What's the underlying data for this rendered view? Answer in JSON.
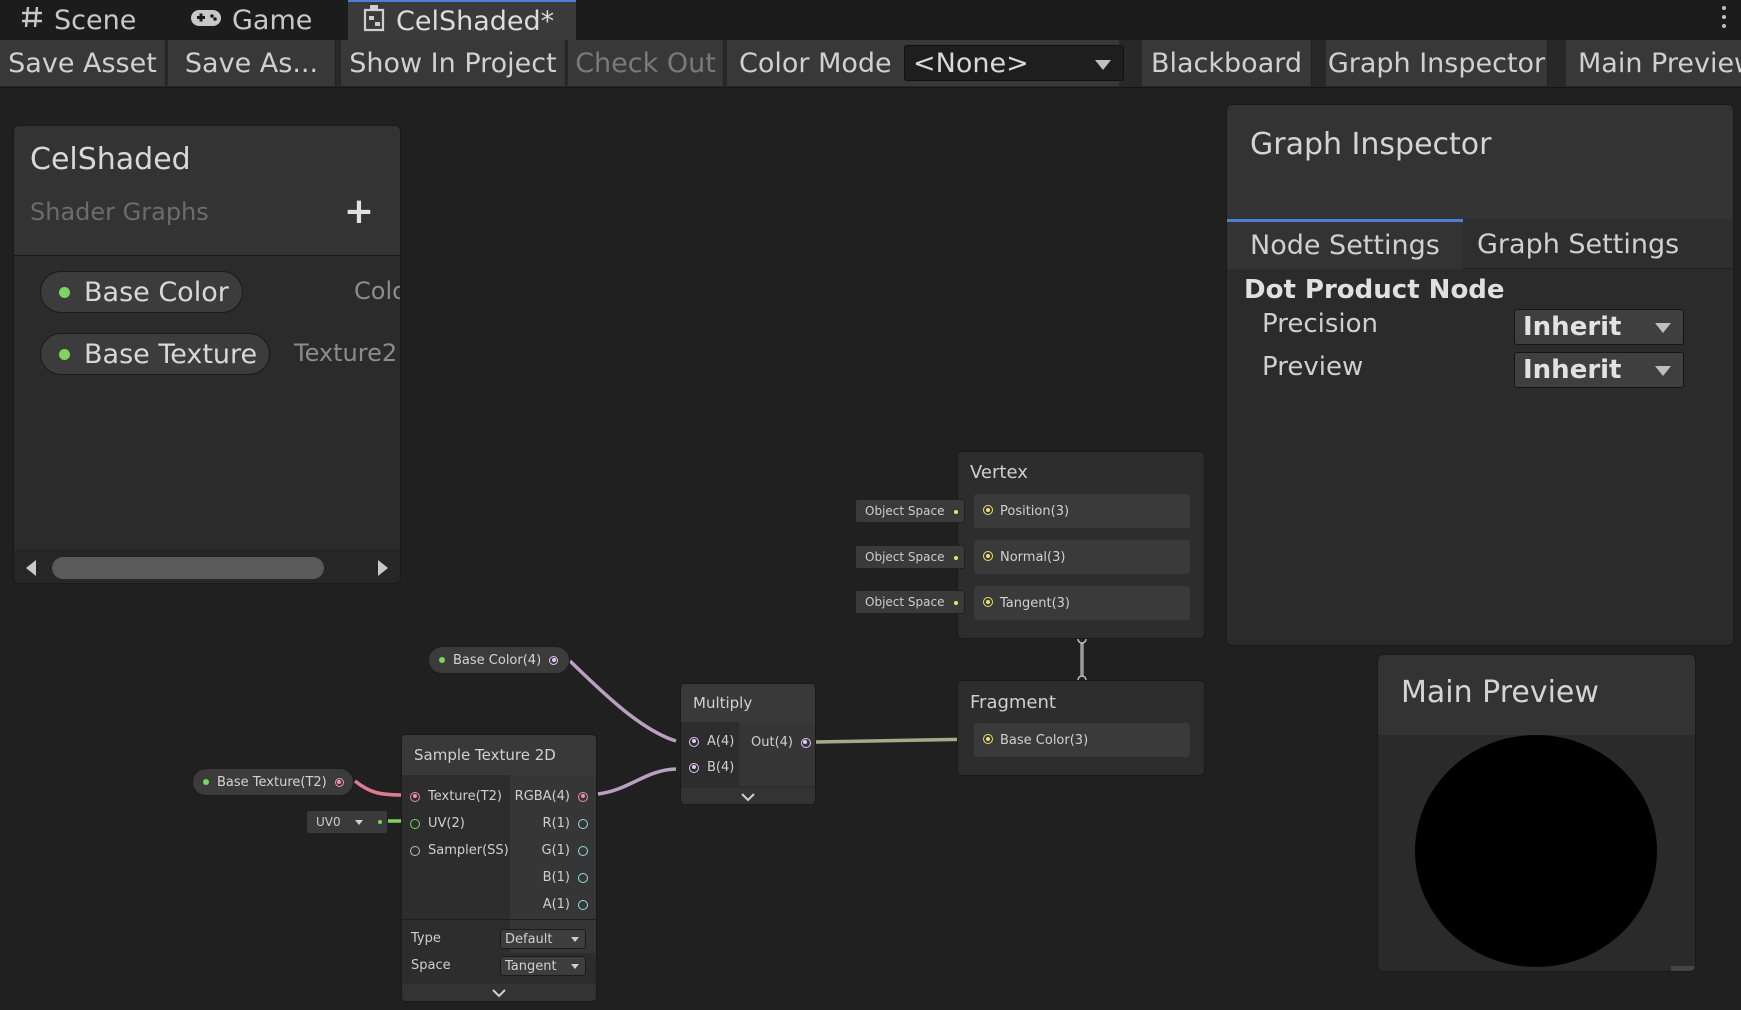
{
  "tabs": [
    {
      "label": "Scene",
      "icon": "scene-grid-icon"
    },
    {
      "label": "Game",
      "icon": "gamepad-icon"
    },
    {
      "label": "CelShaded*",
      "icon": "shader-graph-icon",
      "active": true
    }
  ],
  "toolbar": {
    "save_asset": "Save Asset",
    "save_as": "Save As...",
    "show_in_project": "Show In Project",
    "check_out": "Check Out",
    "color_mode_label": "Color Mode",
    "color_mode_value": "<None>",
    "blackboard": "Blackboard",
    "graph_inspector": "Graph Inspector",
    "main_preview": "Main Preview"
  },
  "blackboard": {
    "title": "CelShaded",
    "subtitle": "Shader Graphs",
    "add_icon": "plus-icon",
    "properties": [
      {
        "name": "Base Color",
        "type": "Colo"
      },
      {
        "name": "Base Texture",
        "type": "Texture2"
      }
    ]
  },
  "inspector": {
    "title": "Graph Inspector",
    "tabs": [
      "Node Settings",
      "Graph Settings"
    ],
    "active_tab": "Node Settings",
    "node_title": "Dot Product Node",
    "fields": [
      {
        "label": "Precision",
        "value": "Inherit"
      },
      {
        "label": "Preview",
        "value": "Inherit"
      }
    ]
  },
  "preview": {
    "title": "Main Preview"
  },
  "graph": {
    "vertex": {
      "title": "Vertex",
      "slots": [
        "Position(3)",
        "Normal(3)",
        "Tangent(3)"
      ],
      "space_label": "Object Space"
    },
    "fragment": {
      "title": "Fragment",
      "slots": [
        "Base Color(3)"
      ]
    },
    "multiply": {
      "title": "Multiply",
      "inputs": [
        "A(4)",
        "B(4)"
      ],
      "output": "Out(4)"
    },
    "sample_texture": {
      "title": "Sample Texture 2D",
      "inputs": [
        "Texture(T2)",
        "UV(2)",
        "Sampler(SS)"
      ],
      "outputs": [
        "RGBA(4)",
        "R(1)",
        "G(1)",
        "B(1)",
        "A(1)"
      ],
      "type_label": "Type",
      "type_value": "Default",
      "space_label": "Space",
      "space_value": "Tangent",
      "uv_value": "UV0"
    },
    "base_color_node": "Base Color(4)",
    "base_texture_node": "Base Texture(T2)"
  },
  "colors": {
    "accent": "#4c7fd4",
    "vector4": "#f092a8",
    "vector3": "#e7e36e",
    "vector2": "#7fd35f",
    "texture": "#f092a8",
    "vector1": "#8fe2e0"
  }
}
